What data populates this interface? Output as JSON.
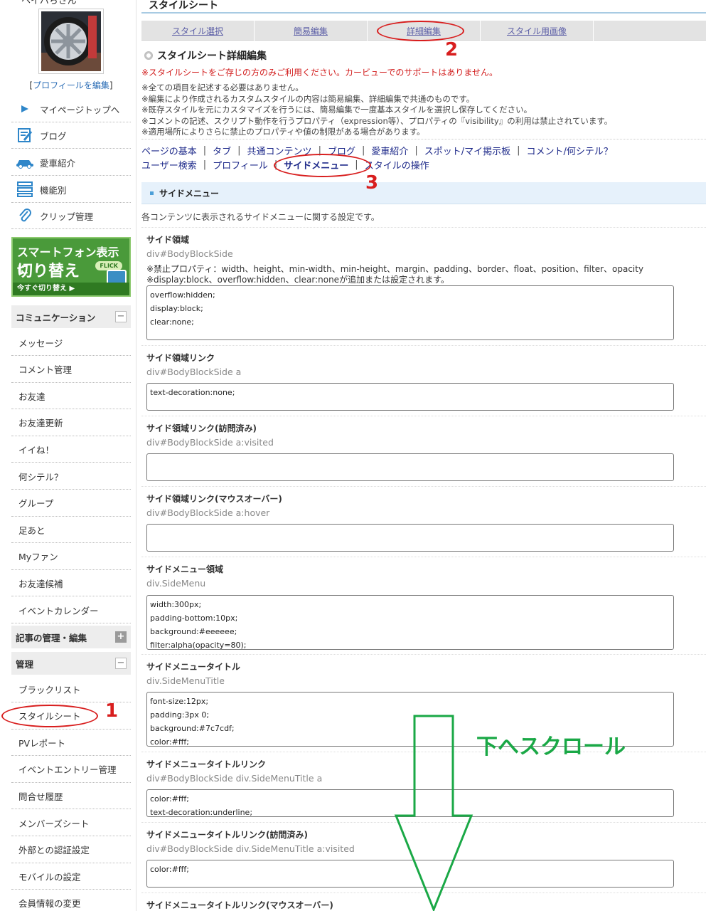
{
  "sidebar": {
    "username": "ヘイハちさん",
    "edit_profile": "プロフィールを編集",
    "nav": [
      {
        "label": "マイページトップへ",
        "icon": "play-arrow-icon"
      },
      {
        "label": "ブログ",
        "icon": "blog-icon"
      },
      {
        "label": "愛車紹介",
        "icon": "car-icon"
      },
      {
        "label": "機能別",
        "icon": "list-icon"
      },
      {
        "label": "クリップ管理",
        "icon": "clip-icon"
      }
    ],
    "banner": {
      "line1": "スマートフォン表示に",
      "line2": "切り替え",
      "flick": "FLICK",
      "cta": "今すぐ切り替え ▶"
    },
    "communication": {
      "title": "コミュニケーション",
      "items": [
        "メッセージ",
        "コメント管理",
        "お友達",
        "お友達更新",
        "イイね！",
        "何シテル？",
        "グループ",
        "足あと",
        "Myファン",
        "お友達候補",
        "イベントカレンダー"
      ]
    },
    "articles": {
      "title": "記事の管理・編集"
    },
    "management": {
      "title": "管理",
      "items": [
        "ブラックリスト",
        "スタイルシート",
        "PVレポート",
        "イベントエントリー管理",
        "問合せ履歴",
        "メンバーズシート",
        "外部との認証設定",
        "モバイルの設定",
        "会員情報の変更"
      ]
    }
  },
  "main": {
    "title": "スタイルシート",
    "tabs": [
      "スタイル選択",
      "簡易編集",
      "詳細編集",
      "スタイル用画像"
    ],
    "editor_title": "スタイルシート詳細編集",
    "warning": "※スタイルシートをご存じの方のみご利用ください。カービューでのサポートはありません。",
    "notes": [
      "※全ての項目を記述する必要はありません。",
      "※編集により作成されるカスタムスタイルの内容は簡易編集、詳細編集で共通のものです。",
      "※既存スタイルを元にカスタマイズを行うには、簡易編集で一度基本スタイルを選択し保存してください。",
      "※コメントの記述、スクリプト動作を行うプロパティ（expression等）、プロパティの『visibility』の利用は禁止されています。",
      "※適用場所によりさらに禁止のプロパティや値の制限がある場合があります。"
    ],
    "links_row1": [
      "ページの基本",
      "タブ",
      "共通コンテンツ",
      "ブログ",
      "愛車紹介",
      "スポット/マイ掲示板",
      "コメント/何シテル？"
    ],
    "links_row2": [
      "ユーザー検索",
      "プロフィール",
      "サイドメニュー",
      "スタイルの操作"
    ],
    "section_title": "サイドメニュー",
    "section_desc": "各コンテンツに表示されるサイドメニューに関する設定です。",
    "fields": [
      {
        "label": "サイド領域",
        "selector": "div#BodyBlockSide",
        "note1": "※禁止プロパティ：width、height、min-width、min-height、margin、padding、border、float、position、filter、opacity",
        "note2": "※display:block、overflow:hidden、clear:noneが追加または設定されます。",
        "lines": [
          "overflow:hidden;",
          "display:block;",
          "clear:none;"
        ]
      },
      {
        "label": "サイド領域リンク",
        "selector": "div#BodyBlockSide a",
        "lines": [
          "text-decoration:none;"
        ]
      },
      {
        "label": "サイド領域リンク(訪問済み)",
        "selector": "div#BodyBlockSide a:visited",
        "lines": []
      },
      {
        "label": "サイド領域リンク(マウスオーバー)",
        "selector": "div#BodyBlockSide a:hover",
        "lines": []
      },
      {
        "label": "サイドメニュー領域",
        "selector": "div.SideMenu",
        "lines": [
          "width:300px;",
          "padding-bottom:10px;",
          "background:#eeeeee;",
          "filter:alpha(opacity=80);"
        ]
      },
      {
        "label": "サイドメニュータイトル",
        "selector": "div.SideMenuTitle",
        "lines": [
          "font-size:12px;",
          "padding:3px 0;",
          "background:#7c7cdf;",
          "color:#fff;"
        ]
      },
      {
        "label": "サイドメニュータイトルリンク",
        "selector": "div#BodyBlockSide div.SideMenuTitle a",
        "lines": [
          "color:#fff;",
          "text-decoration:underline;"
        ]
      },
      {
        "label": "サイドメニュータイトルリンク(訪問済み)",
        "selector": "div#BodyBlockSide div.SideMenuTitle a:visited",
        "lines": [
          "color:#fff;"
        ]
      },
      {
        "label": "サイドメニュータイトルリンク(マウスオーバー)",
        "selector": "",
        "lines": []
      }
    ]
  },
  "annotations": {
    "n1": "1",
    "n2": "2",
    "n3": "3",
    "scroll_text": "下へスクロール"
  },
  "colors": {
    "accent_red": "#d81e1e",
    "scroll_green": "#1aa846",
    "link_blue": "#1e2a8a"
  }
}
